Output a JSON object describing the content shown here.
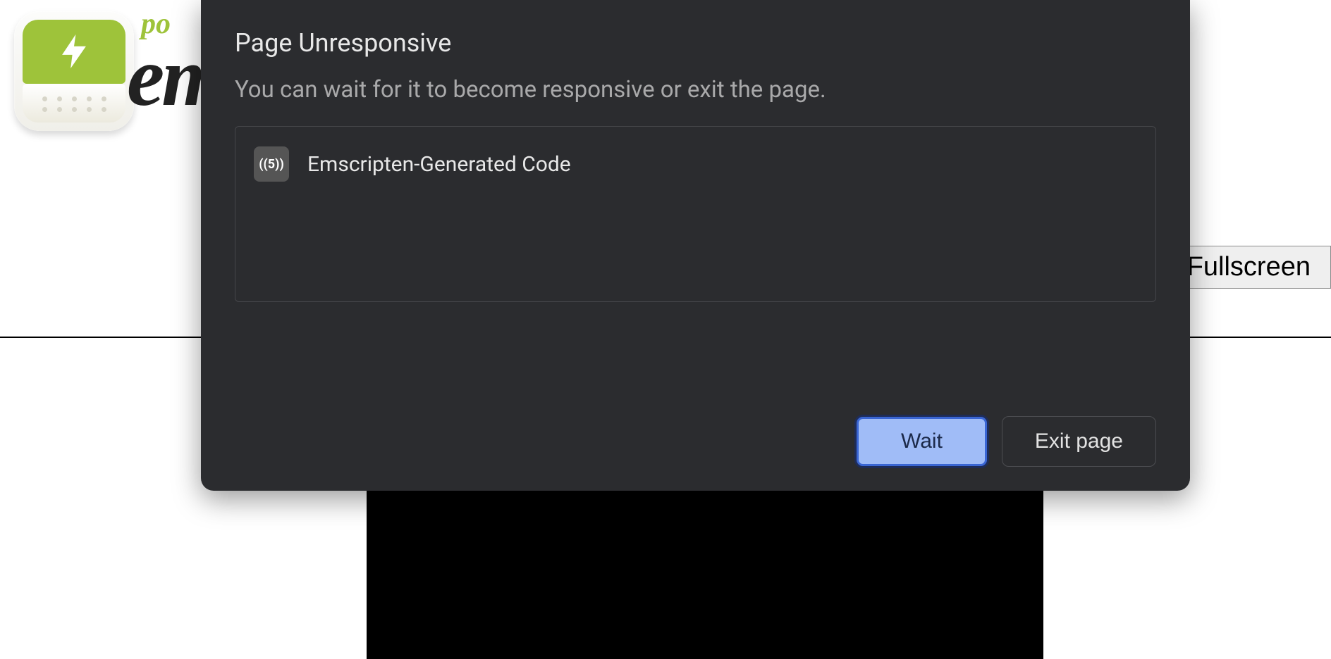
{
  "brand": {
    "partial_top": "po",
    "partial_main": "em"
  },
  "page": {
    "fullscreen_label": "Fullscreen"
  },
  "dialog": {
    "title": "Page Unresponsive",
    "message": "You can wait for it to become responsive or exit the page.",
    "items": [
      {
        "favicon_text": "((5))",
        "label": "Emscripten-Generated Code"
      }
    ],
    "wait_label": "Wait",
    "exit_label": "Exit page"
  }
}
